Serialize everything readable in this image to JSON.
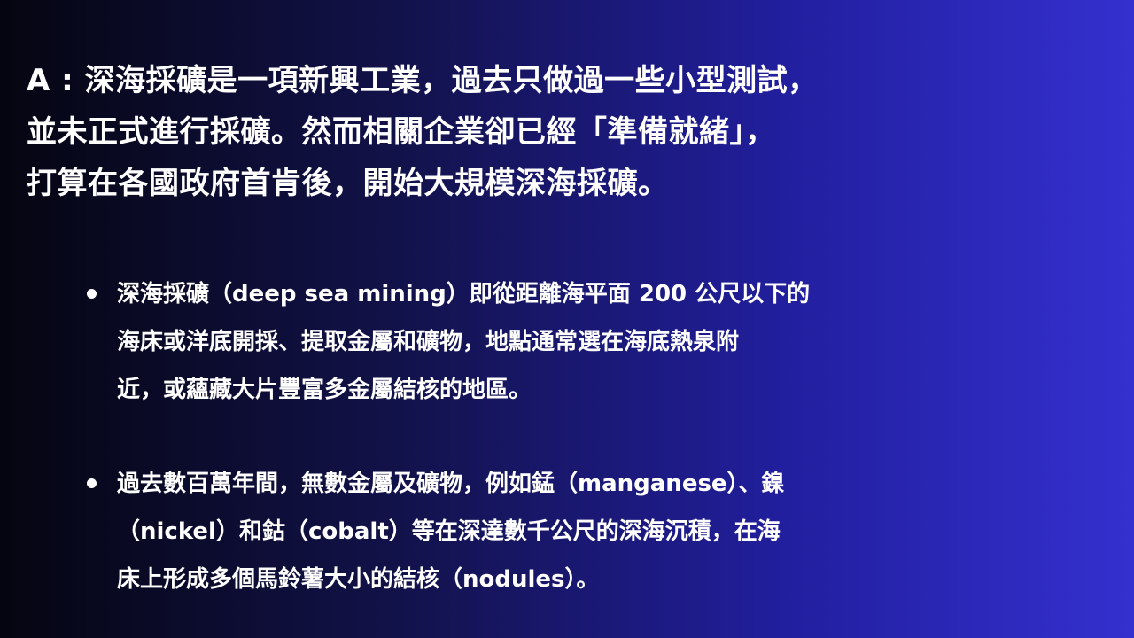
{
  "heading": {
    "lines": [
      " A : 深海採礦是一項新興工業，過去只做過一些小型測試，",
      "並未正式進行採礦。然而相關企業卻已經「準備就緒」，",
      "打算在各國政府首肯後，開始大規模深海採礦。"
    ]
  },
  "bullets": [
    {
      "lines": [
        "深海採礦（deep sea mining）即從距離海平面 200 公尺以下的",
        "海床或洋底開採、提取金屬和礦物，地點通常選在海底熱泉附",
        "近，或蘊藏大片豐富多金屬結核的地區。"
      ]
    },
    {
      "lines": [
        "過去數百萬年間，無數金屬及礦物，例如錳（manganese）、鎳",
        "（nickel）和鈷（cobalt）等在深達數千公尺的深海沉積，在海",
        "床上形成多個馬鈴薯大小的結核（nodules）。"
      ]
    }
  ]
}
